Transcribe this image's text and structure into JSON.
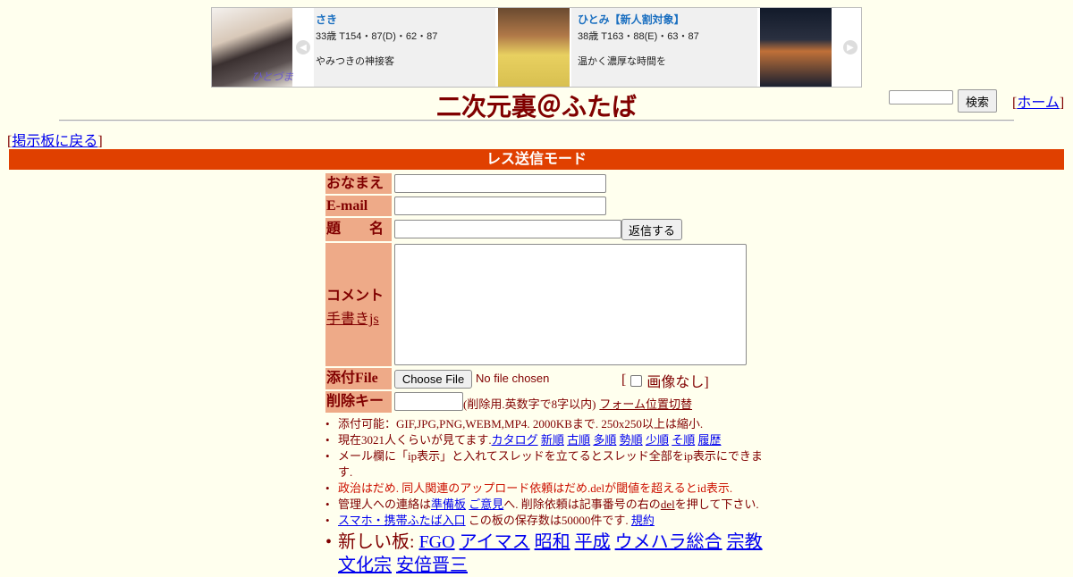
{
  "ad": {
    "cards": [
      {
        "name": "さき",
        "spec": "33歳 T154・87(D)・62・87",
        "message": "やみつきの神接客"
      },
      {
        "name": "ひとみ【新人割対象】",
        "spec": "38歳 T163・88(E)・63・87",
        "message": "温かく濃厚な時間を"
      }
    ],
    "logo_text": "ひとづま",
    "prev_icon": "◀",
    "next_icon": "▶"
  },
  "header": {
    "title": "二次元裏＠ふたば",
    "search_button": "検索",
    "home_open": "[",
    "home_link": "ホーム",
    "home_close": "]"
  },
  "nav": {
    "back_open": "[",
    "back_link": "掲示板に戻る",
    "back_close": "]"
  },
  "mode_bar": "レス送信モード",
  "form": {
    "name_label": "おなまえ",
    "email_label": "E-mail",
    "subject_label": "題　　名",
    "reply_button": "返信する",
    "comment_label": "コメント",
    "handwriting_link": "手書きjs",
    "file_label": "添付File",
    "choose_file_button": "Choose File",
    "no_file_text": "No file chosen",
    "no_image_open": "[",
    "no_image_label": "画像なし]",
    "delkey_label": "削除キー",
    "delkey_note": "(削除用.英数字で8字以内)",
    "form_switch_link": "フォーム位置切替"
  },
  "rules": {
    "r1": "添付可能：GIF,JPG,PNG,WEBM,MP4. 2000KBまで. 250x250以上は縮小.",
    "r2_prefix": "現在3021人くらいが見てます.",
    "r2_links": [
      "カタログ",
      "新順",
      "古順",
      "多順",
      "勢順",
      "少順",
      "そ順",
      "履歴"
    ],
    "r3": "メール欄に「ip表示」と入れてスレッドを立てるとスレッド全部をip表示にできます.",
    "r4": "政治はだめ. 同人関連のアップロード依頼はだめ.delが閾値を超えるとid表示.",
    "r5_a": "管理人への連絡は",
    "r5_link1": "準備板",
    "r5_b": "ご意見",
    "r5_c": "へ. 削除依頼は記事番号の右の",
    "r5_del": "del",
    "r5_d": "を押して下さい.",
    "r6_link": "スマホ・携帯ふたば入口",
    "r6_text": "この板の保存数は50000件です.",
    "r6_link2": "規約",
    "r7_prefix": "新しい板:",
    "r7_links": [
      "FGO",
      "アイマス",
      "昭和",
      "平成",
      "ウメハラ総合",
      "宗教",
      "文化宗",
      "安倍晋三"
    ]
  }
}
